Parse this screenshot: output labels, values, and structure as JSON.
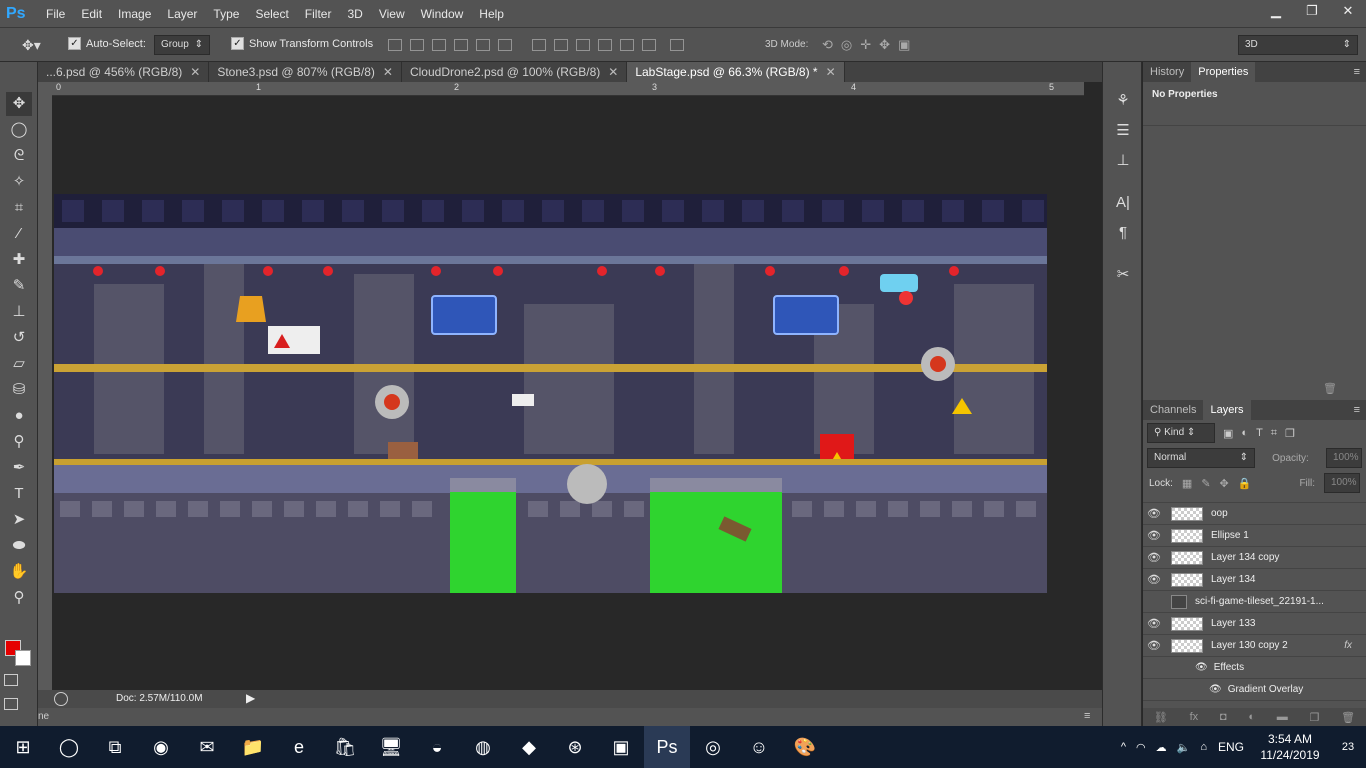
{
  "app": {
    "logo": "Ps"
  },
  "menubar": {
    "items": [
      "File",
      "Edit",
      "Image",
      "Layer",
      "Type",
      "Select",
      "Filter",
      "3D",
      "View",
      "Window",
      "Help"
    ]
  },
  "window_controls": {
    "minimize": "▁",
    "restore": "❐",
    "close": "✕"
  },
  "options": {
    "auto_select_label": "Auto-Select:",
    "auto_select_checked": true,
    "auto_select_value": "Group",
    "show_transform_label": "Show Transform Controls",
    "show_transform_checked": true,
    "mode_label": "3D Mode:",
    "workspace_value": "3D"
  },
  "tabs": [
    {
      "label": "...6.psd @ 456% (RGB/8)",
      "close": "✕"
    },
    {
      "label": "Stone3.psd @ 807% (RGB/8)",
      "close": "✕"
    },
    {
      "label": "CloudDrone2.psd @ 100% (RGB/8)",
      "close": "✕"
    },
    {
      "label": "LabStage.psd @ 66.3% (RGB/8) *",
      "close": "✕"
    }
  ],
  "ruler": {
    "ticks": [
      "0",
      "1",
      "2",
      "3",
      "4",
      "5"
    ]
  },
  "status": {
    "doc": "Doc: 2.57M/110.0M"
  },
  "hscroll": {
    "label": "ne"
  },
  "properties": {
    "tabs": [
      "History",
      "Properties"
    ],
    "active_tab": "Properties",
    "content": "No Properties"
  },
  "layers_panel": {
    "tabs": [
      "Channels",
      "Layers"
    ],
    "active_tab": "Layers",
    "filter_label": "Kind",
    "blend_mode": "Normal",
    "opacity_label": "Opacity:",
    "opacity_value": "100%",
    "lock_label": "Lock:",
    "fill_label": "Fill:",
    "fill_value": "100%",
    "layers": [
      {
        "name": "oop",
        "visible": true
      },
      {
        "name": "Ellipse 1",
        "visible": true
      },
      {
        "name": "Layer 134 copy",
        "visible": true
      },
      {
        "name": "Layer 134",
        "visible": true
      },
      {
        "name": "sci-fi-game-tileset_22191-1...",
        "visible": false
      },
      {
        "name": "Layer 133",
        "visible": true
      },
      {
        "name": "Layer 130 copy 2",
        "visible": true,
        "fx": "fx"
      }
    ],
    "effects_label": "Effects",
    "effect_item": "Gradient Overlay"
  },
  "taskbar": {
    "language": "ENG",
    "time": "3:54 AM",
    "date": "11/24/2019",
    "notifications": "23"
  },
  "colors": {
    "ps_blue": "#31a8ff",
    "foreground": "#e50000",
    "background": "#ffffff",
    "acid": "#2fd42f",
    "warning": "#f5c400"
  }
}
